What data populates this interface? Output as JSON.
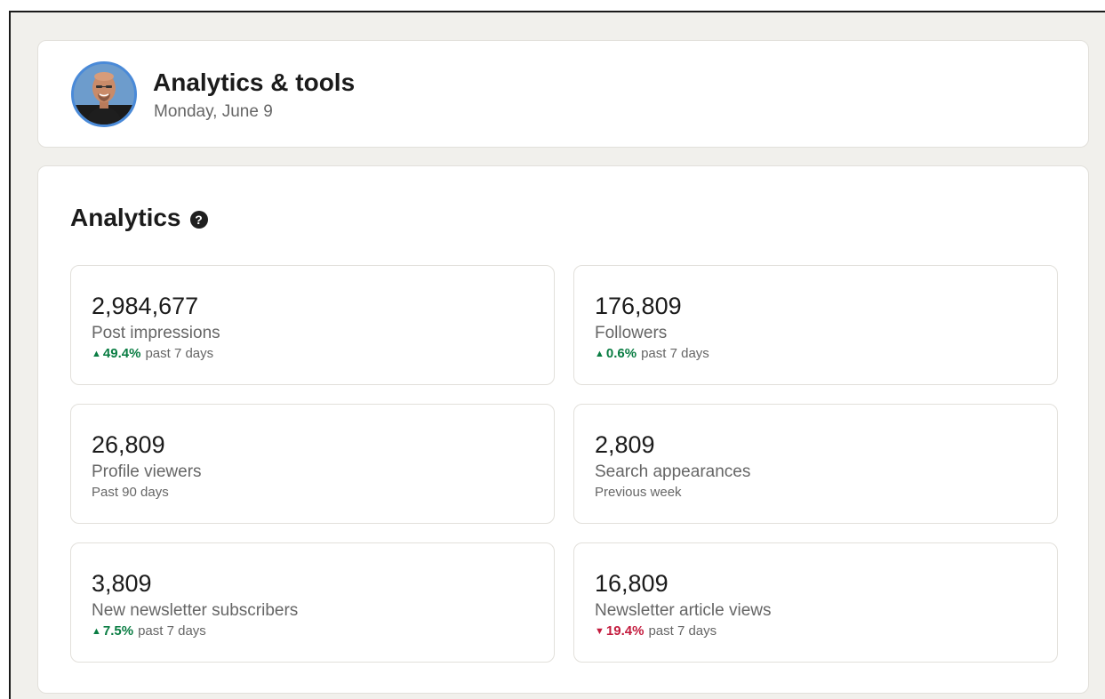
{
  "header": {
    "title": "Analytics & tools",
    "date": "Monday, June 9"
  },
  "analytics": {
    "title": "Analytics",
    "help_icon": "question-circle-icon",
    "tiles": [
      {
        "value": "2,984,677",
        "label": "Post impressions",
        "change": "49.4%",
        "change_direction": "up",
        "period": "past 7 days"
      },
      {
        "value": "176,809",
        "label": "Followers",
        "change": "0.6%",
        "change_direction": "up",
        "period": "past 7 days"
      },
      {
        "value": "26,809",
        "label": "Profile viewers",
        "period": "Past 90 days"
      },
      {
        "value": "2,809",
        "label": "Search appearances",
        "period": "Previous week"
      },
      {
        "value": "3,809",
        "label": "New newsletter subscribers",
        "change": "7.5%",
        "change_direction": "up",
        "period": "past 7 days"
      },
      {
        "value": "16,809",
        "label": "Newsletter article views",
        "change": "19.4%",
        "change_direction": "down",
        "period": "past 7 days"
      }
    ]
  },
  "colors": {
    "positive": "#0a7d43",
    "negative": "#c41d3f",
    "background": "#f1f0ec",
    "avatar_ring": "#4a8ad8"
  }
}
